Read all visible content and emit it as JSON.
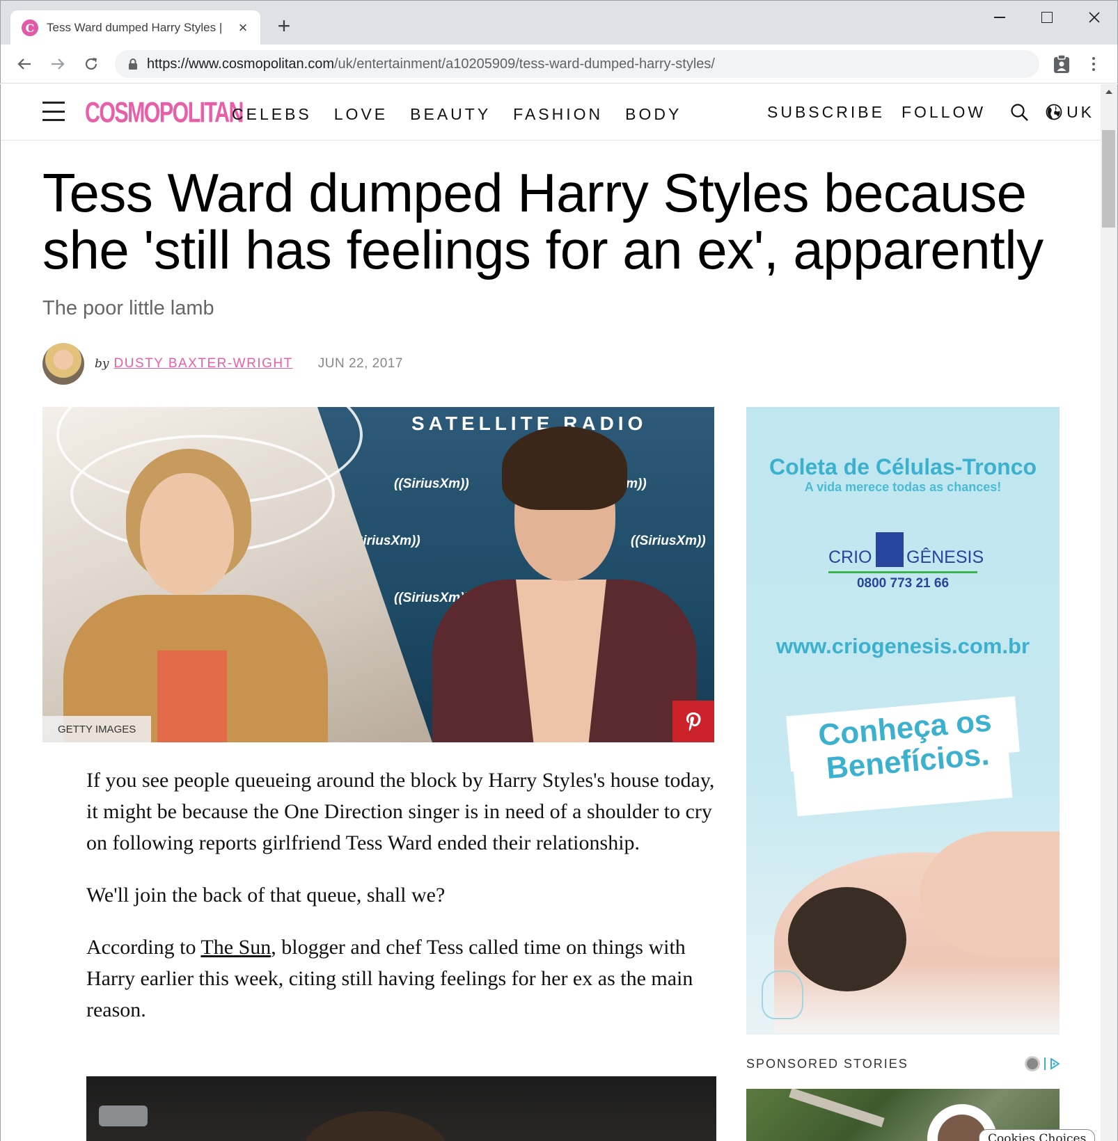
{
  "browser": {
    "tab_title": "Tess Ward dumped Harry Styles |",
    "url_scheme_host": "https://www.cosmopolitan.com",
    "url_path": "/uk/entertainment/a10205909/tess-ward-dumped-harry-styles/"
  },
  "site": {
    "logo": "COSMOPOLITAN",
    "nav": [
      "CELEBS",
      "LOVE",
      "BEAUTY",
      "FASHION",
      "BODY"
    ],
    "subscribe": "SUBSCRIBE",
    "follow": "FOLLOW",
    "region": "UK"
  },
  "article": {
    "headline": "Tess Ward dumped Harry Styles because she 'still has feelings for an ex', apparently",
    "dek": "The poor little lamb",
    "by": "by",
    "author": "DUSTY BAXTER-WRIGHT",
    "date": "JUN 22, 2017",
    "hero_text": {
      "satellite_radio": "SATELLITE RADIO",
      "sirius_logo": "((SiriusXm))"
    },
    "photo_credit": "GETTY IMAGES",
    "paragraphs": {
      "p1": "If you see people queueing around the block by Harry Styles's house today, it might be because the One Direction singer is in need of a shoulder to cry on following reports girlfriend Tess Ward ended their relationship.",
      "p2": "We'll join the back of that queue, shall we?",
      "p3_before": "According to ",
      "p3_link": "The Sun",
      "p3_after": ", blogger and chef Tess called time on things with Harry earlier this week, citing still having feelings for her ex as the main reason."
    }
  },
  "ad": {
    "title": "Coleta de Células-Tronco",
    "subtitle": "A vida merece todas as chances!",
    "brand_left": "CRIO",
    "brand_right": "GÊNESIS",
    "phone": "0800 773 21 66",
    "url": "www.criogenesis.com.br",
    "cta": "Conheça os Benefícios."
  },
  "sponsored": {
    "label": "SPONSORED STORIES"
  },
  "cookies": "Cookies Choices",
  "colors": {
    "brand_pink": "#e85fa8",
    "pinterest_red": "#cc2229",
    "ad_blue": "#3bb1cf"
  }
}
